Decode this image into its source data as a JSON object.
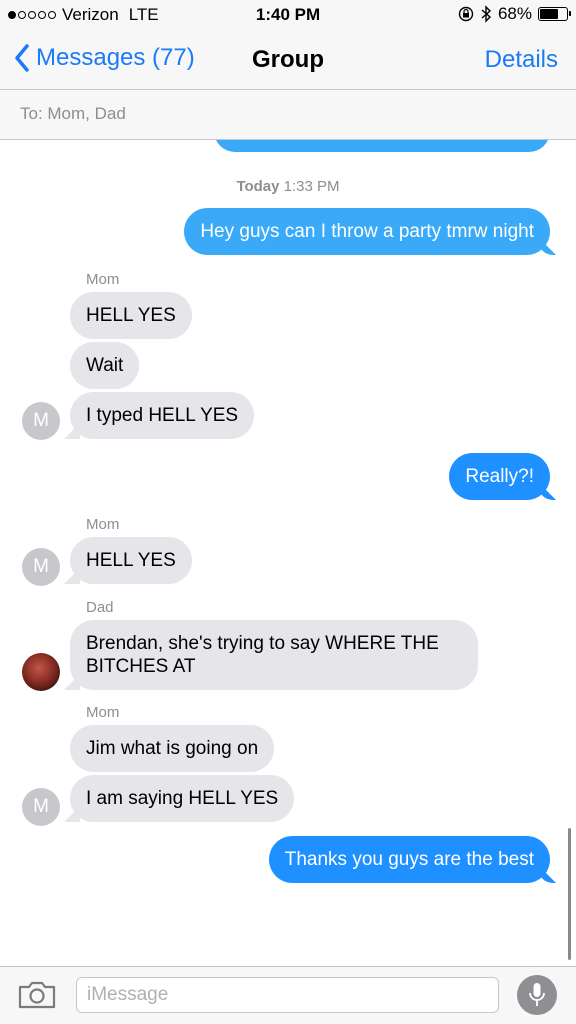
{
  "status_bar": {
    "carrier": "Verizon",
    "network": "LTE",
    "time": "1:40 PM",
    "battery": "68%",
    "battery_level": 0.68,
    "signal_bars": 1
  },
  "nav": {
    "back_label": "Messages (77)",
    "title": "Group",
    "details_label": "Details"
  },
  "recipients": "To: Mom, Dad",
  "timestamp": {
    "day": "Today",
    "time": "1:33 PM"
  },
  "messages": [
    {
      "text": "Hey guys can I throw a party tmrw night"
    },
    {
      "sender": "Mom",
      "text": "HELL YES"
    },
    {
      "text": "Wait"
    },
    {
      "text": "I typed HELL YES",
      "avatar": "M"
    },
    {
      "text": "Really?!"
    },
    {
      "sender": "Mom",
      "text": "HELL YES",
      "avatar": "M"
    },
    {
      "sender": "Dad",
      "text": "Brendan, she's trying to say WHERE THE BITCHES AT"
    },
    {
      "sender": "Mom",
      "text": "Jim what is going on"
    },
    {
      "text": "I am saying HELL YES",
      "avatar": "M"
    },
    {
      "text": "Thanks you guys are the best"
    }
  ],
  "composer": {
    "placeholder": "iMessage",
    "value": ""
  },
  "colors": {
    "accent": "#1a7af8",
    "outgoing": "#1e90ff",
    "incoming": "#e5e5ea"
  },
  "icons": [
    "chevron-left-icon",
    "camera-icon",
    "microphone-icon",
    "lock-rotation-icon",
    "bluetooth-icon",
    "battery-icon"
  ]
}
